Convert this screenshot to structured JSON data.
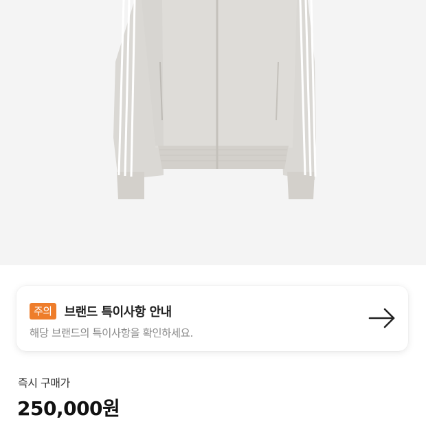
{
  "product": {
    "image": "light-gray-track-jacket-with-white-stripes"
  },
  "notice": {
    "badge": "주의",
    "title": "브랜드 특이사항 안내",
    "description": "해당 브랜드의 특이사항을 확인하세요.",
    "arrow_icon": "right-arrow-icon",
    "badge_color": "#ee7d2b"
  },
  "price": {
    "label": "즉시 구매가",
    "value": "250,000원"
  }
}
